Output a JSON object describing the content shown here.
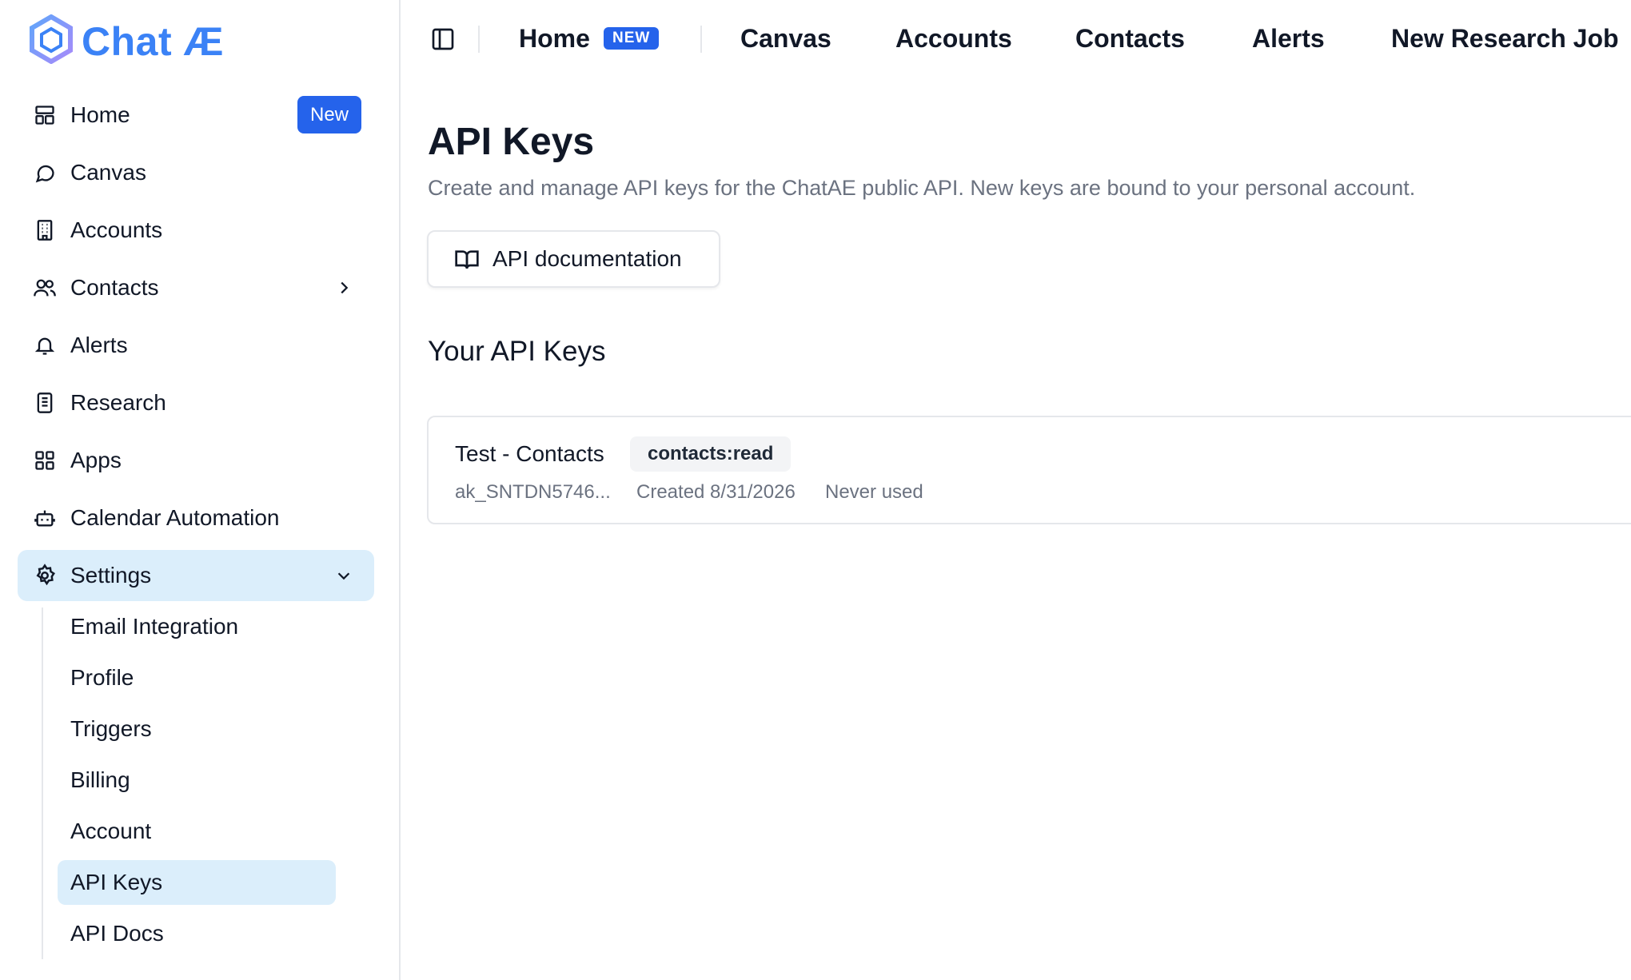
{
  "app": {
    "name": "Chat ÆE",
    "logo_text": "Chat Æ"
  },
  "sidebar": {
    "items": [
      {
        "label": "Home",
        "icon": "layout-icon",
        "badge": "New"
      },
      {
        "label": "Canvas",
        "icon": "chat-bubble-icon"
      },
      {
        "label": "Accounts",
        "icon": "building-icon"
      },
      {
        "label": "Contacts",
        "icon": "users-icon"
      },
      {
        "label": "Alerts",
        "icon": "bell-icon"
      },
      {
        "label": "Research",
        "icon": "document-icon"
      },
      {
        "label": "Apps",
        "icon": "grid-icon"
      },
      {
        "label": "Calendar Automation",
        "icon": "bot-icon"
      },
      {
        "label": "Settings",
        "icon": "gear-icon"
      }
    ],
    "settings_sub": [
      {
        "label": "Email Integration"
      },
      {
        "label": "Profile"
      },
      {
        "label": "Triggers"
      },
      {
        "label": "Billing"
      },
      {
        "label": "Account"
      },
      {
        "label": "API Keys"
      },
      {
        "label": "API Docs"
      }
    ]
  },
  "topbar": {
    "links": [
      "Home",
      "Canvas",
      "Accounts",
      "Contacts",
      "Alerts",
      "New Research Job"
    ],
    "home_badge": "NEW"
  },
  "main": {
    "title": "API Keys",
    "description": "Create and manage API keys for the ChatAE public API. New keys are bound to your personal account.",
    "doc_button": "API documentation",
    "section_title": "Your API Keys",
    "keys": [
      {
        "name": "Test - Contacts",
        "scope": "contacts:read",
        "key_prefix": "ak_SNTDN5746...",
        "created": "Created 8/31/2026",
        "last_used": "Never used"
      }
    ]
  },
  "colors": {
    "accent": "#2563eb",
    "active_bg": "#dbeefb",
    "logo": "#3b82f6"
  }
}
